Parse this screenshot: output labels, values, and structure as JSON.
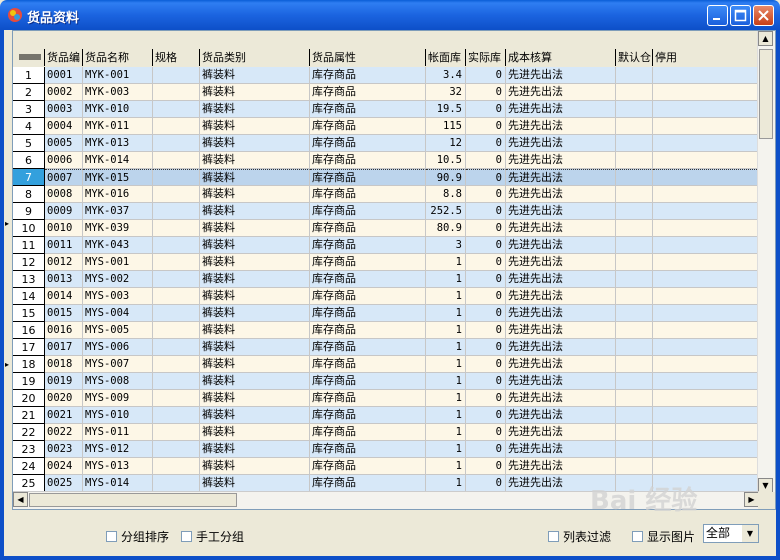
{
  "window": {
    "title": "货品资料"
  },
  "columns": [
    "货品编",
    "货品名称",
    "规格",
    "货品类别",
    "货品属性",
    "帐面库",
    "实际库",
    "成本核算",
    "默认仓",
    "停用"
  ],
  "rows": [
    {
      "n": "1",
      "code": "0001",
      "name": "MYK-001",
      "spec": "",
      "cat": "裤装料",
      "attr": "库存商品",
      "book": "3.4",
      "actual": "0",
      "cost": "先进先出法"
    },
    {
      "n": "2",
      "code": "0002",
      "name": "MYK-003",
      "spec": "",
      "cat": "裤装料",
      "attr": "库存商品",
      "book": "32",
      "actual": "0",
      "cost": "先进先出法"
    },
    {
      "n": "3",
      "code": "0003",
      "name": "MYK-010",
      "spec": "",
      "cat": "裤装料",
      "attr": "库存商品",
      "book": "19.5",
      "actual": "0",
      "cost": "先进先出法"
    },
    {
      "n": "4",
      "code": "0004",
      "name": "MYK-011",
      "spec": "",
      "cat": "裤装料",
      "attr": "库存商品",
      "book": "115",
      "actual": "0",
      "cost": "先进先出法"
    },
    {
      "n": "5",
      "code": "0005",
      "name": "MYK-013",
      "spec": "",
      "cat": "裤装料",
      "attr": "库存商品",
      "book": "12",
      "actual": "0",
      "cost": "先进先出法"
    },
    {
      "n": "6",
      "code": "0006",
      "name": "MYK-014",
      "spec": "",
      "cat": "裤装料",
      "attr": "库存商品",
      "book": "10.5",
      "actual": "0",
      "cost": "先进先出法"
    },
    {
      "n": "7",
      "code": "0007",
      "name": "MYK-015",
      "spec": "",
      "cat": "裤装料",
      "attr": "库存商品",
      "book": "90.9",
      "actual": "0",
      "cost": "先进先出法"
    },
    {
      "n": "8",
      "code": "0008",
      "name": "MYK-016",
      "spec": "",
      "cat": "裤装料",
      "attr": "库存商品",
      "book": "8.8",
      "actual": "0",
      "cost": "先进先出法"
    },
    {
      "n": "9",
      "code": "0009",
      "name": "MYK-037",
      "spec": "",
      "cat": "裤装料",
      "attr": "库存商品",
      "book": "252.5",
      "actual": "0",
      "cost": "先进先出法"
    },
    {
      "n": "10",
      "code": "0010",
      "name": "MYK-039",
      "spec": "",
      "cat": "裤装料",
      "attr": "库存商品",
      "book": "80.9",
      "actual": "0",
      "cost": "先进先出法"
    },
    {
      "n": "11",
      "code": "0011",
      "name": "MYK-043",
      "spec": "",
      "cat": "裤装料",
      "attr": "库存商品",
      "book": "3",
      "actual": "0",
      "cost": "先进先出法"
    },
    {
      "n": "12",
      "code": "0012",
      "name": "MYS-001",
      "spec": "",
      "cat": "裤装料",
      "attr": "库存商品",
      "book": "1",
      "actual": "0",
      "cost": "先进先出法"
    },
    {
      "n": "13",
      "code": "0013",
      "name": "MYS-002",
      "spec": "",
      "cat": "裤装料",
      "attr": "库存商品",
      "book": "1",
      "actual": "0",
      "cost": "先进先出法"
    },
    {
      "n": "14",
      "code": "0014",
      "name": "MYS-003",
      "spec": "",
      "cat": "裤装料",
      "attr": "库存商品",
      "book": "1",
      "actual": "0",
      "cost": "先进先出法"
    },
    {
      "n": "15",
      "code": "0015",
      "name": "MYS-004",
      "spec": "",
      "cat": "裤装料",
      "attr": "库存商品",
      "book": "1",
      "actual": "0",
      "cost": "先进先出法"
    },
    {
      "n": "16",
      "code": "0016",
      "name": "MYS-005",
      "spec": "",
      "cat": "裤装料",
      "attr": "库存商品",
      "book": "1",
      "actual": "0",
      "cost": "先进先出法"
    },
    {
      "n": "17",
      "code": "0017",
      "name": "MYS-006",
      "spec": "",
      "cat": "裤装料",
      "attr": "库存商品",
      "book": "1",
      "actual": "0",
      "cost": "先进先出法"
    },
    {
      "n": "18",
      "code": "0018",
      "name": "MYS-007",
      "spec": "",
      "cat": "裤装料",
      "attr": "库存商品",
      "book": "1",
      "actual": "0",
      "cost": "先进先出法"
    },
    {
      "n": "19",
      "code": "0019",
      "name": "MYS-008",
      "spec": "",
      "cat": "裤装料",
      "attr": "库存商品",
      "book": "1",
      "actual": "0",
      "cost": "先进先出法"
    },
    {
      "n": "20",
      "code": "0020",
      "name": "MYS-009",
      "spec": "",
      "cat": "裤装料",
      "attr": "库存商品",
      "book": "1",
      "actual": "0",
      "cost": "先进先出法"
    },
    {
      "n": "21",
      "code": "0021",
      "name": "MYS-010",
      "spec": "",
      "cat": "裤装料",
      "attr": "库存商品",
      "book": "1",
      "actual": "0",
      "cost": "先进先出法"
    },
    {
      "n": "22",
      "code": "0022",
      "name": "MYS-011",
      "spec": "",
      "cat": "裤装料",
      "attr": "库存商品",
      "book": "1",
      "actual": "0",
      "cost": "先进先出法"
    },
    {
      "n": "23",
      "code": "0023",
      "name": "MYS-012",
      "spec": "",
      "cat": "裤装料",
      "attr": "库存商品",
      "book": "1",
      "actual": "0",
      "cost": "先进先出法"
    },
    {
      "n": "24",
      "code": "0024",
      "name": "MYS-013",
      "spec": "",
      "cat": "裤装料",
      "attr": "库存商品",
      "book": "1",
      "actual": "0",
      "cost": "先进先出法"
    },
    {
      "n": "25",
      "code": "0025",
      "name": "MYS-014",
      "spec": "",
      "cat": "裤装料",
      "attr": "库存商品",
      "book": "1",
      "actual": "0",
      "cost": "先进先出法"
    }
  ],
  "selected_row": "7",
  "footer": {
    "group_sort": "分组排序",
    "manual_group": "手工分组",
    "list_filter": "列表过滤",
    "show_image": "显示图片",
    "filter_value": "全部"
  },
  "watermark": "Bai 经验",
  "colors": {
    "title_bar": "#1b64e0",
    "row_odd": "#d7e8f8",
    "row_even": "#fdf7e7",
    "selected_num": "#33a0dd"
  }
}
